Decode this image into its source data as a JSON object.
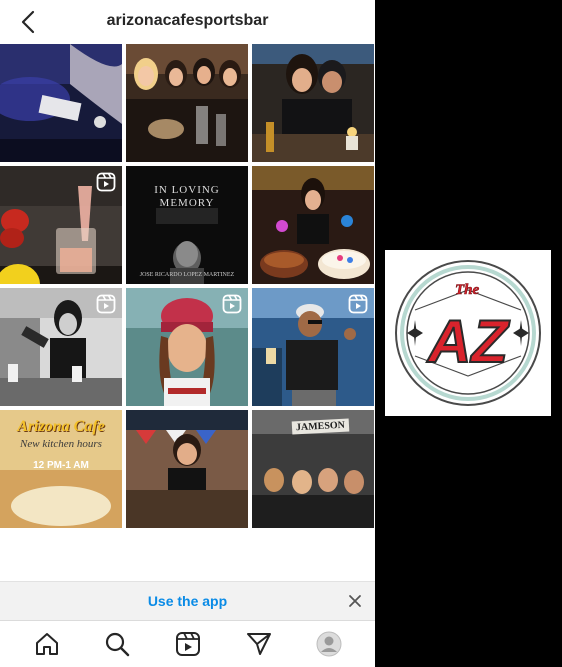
{
  "header": {
    "username": "arizonacafesportsbar"
  },
  "posts": {
    "memorial_title_line1": "IN LOVING",
    "memorial_title_line2": "MEMORY",
    "memorial_name": "JOSE RICARDO LOPEZ MARTINEZ",
    "cafe_name": "Arizona Cafe",
    "cafe_sub": "New kitchen hours",
    "cafe_hours": "12 PM-1 AM",
    "jameson_sign": "JAMESON"
  },
  "banner": {
    "link_label": "Use the app"
  },
  "nav": {
    "items": [
      "home-icon",
      "search-icon",
      "reels-icon",
      "send-icon",
      "profile-avatar-icon"
    ]
  },
  "logo": {
    "text_the": "The",
    "text_az": "AZ"
  },
  "colors": {
    "link": "#0a8be6",
    "logo_red": "#d9232c",
    "logo_ring": "#4a4a4a",
    "logo_ring_inner": "#b6d8d0"
  }
}
